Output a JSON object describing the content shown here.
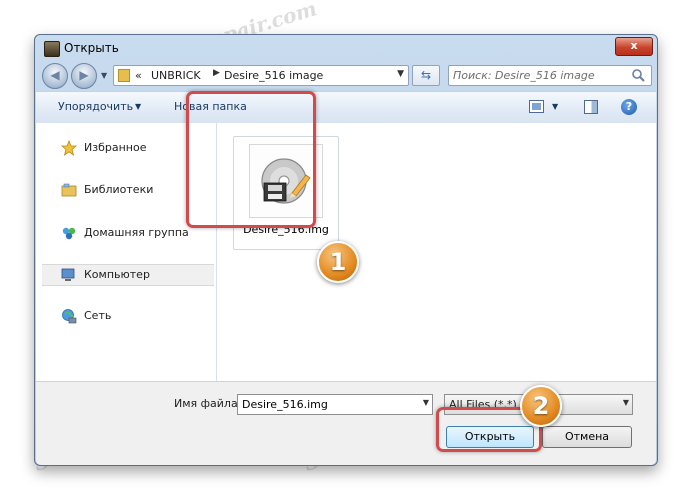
{
  "window": {
    "title": "Открыть",
    "close_glyph": "x"
  },
  "nav": {
    "back_glyph": "◀",
    "forward_glyph": "▶",
    "breadcrumb": [
      "UNBRICK",
      "Desire_516 image"
    ],
    "breadcrumb_prefix": "«",
    "search_placeholder": "Поиск: Desire_516 image"
  },
  "toolbar": {
    "organize_label": "Упорядочить",
    "new_folder_label": "Новая папка",
    "help_glyph": "?"
  },
  "sidebar": {
    "items": [
      {
        "label": "Избранное",
        "icon": "star-icon"
      },
      {
        "label": "Библиотеки",
        "icon": "library-icon"
      },
      {
        "label": "Домашняя группа",
        "icon": "homegroup-icon"
      },
      {
        "label": "Компьютер",
        "icon": "computer-icon",
        "selected": true
      },
      {
        "label": "Сеть",
        "icon": "network-icon"
      }
    ]
  },
  "files": [
    {
      "name": "Desire_516.img",
      "icon": "disk-image-icon",
      "selected": true
    }
  ],
  "footer": {
    "filename_label": "Имя файла:",
    "filename_value": "Desire_516.img",
    "filter_value": "All Files (*.*)",
    "open_label": "Открыть",
    "cancel_label": "Отмена"
  },
  "annotations": {
    "step1": "1",
    "step2": "2"
  },
  "watermark": "Soringpcrepair.com",
  "colors": {
    "highlight": "#d44a4a",
    "badge": "#e38a21",
    "frame": "#b3cbe5"
  }
}
